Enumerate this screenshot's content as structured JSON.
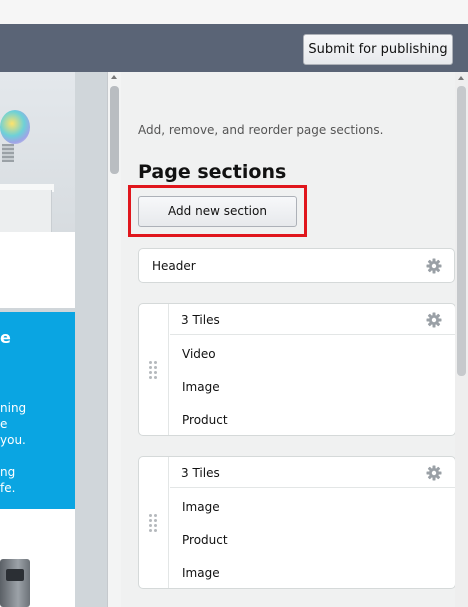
{
  "header": {
    "submit_label": "Submit for publishing"
  },
  "preview": {
    "blue_heading": "e",
    "blue_lines": [
      "ning",
      "e",
      "you.",
      "",
      "ng",
      "fe."
    ]
  },
  "panel": {
    "help_text": "Add, remove, and reorder page sections.",
    "title": "Page sections",
    "add_label": "Add new section"
  },
  "sections": {
    "header_label": "Header",
    "tiles_a": {
      "title": "3 Tiles",
      "items": [
        "Video",
        "Image",
        "Product"
      ]
    },
    "tiles_b": {
      "title": "3 Tiles",
      "items": [
        "Image",
        "Product",
        "Image"
      ]
    }
  },
  "colors": {
    "header_bar": "#5a6476",
    "highlight": "#e0161c",
    "preview_blue": "#0aa5e2"
  },
  "icons": {
    "settings": "gear-icon",
    "drag": "drag-handle-icon"
  }
}
